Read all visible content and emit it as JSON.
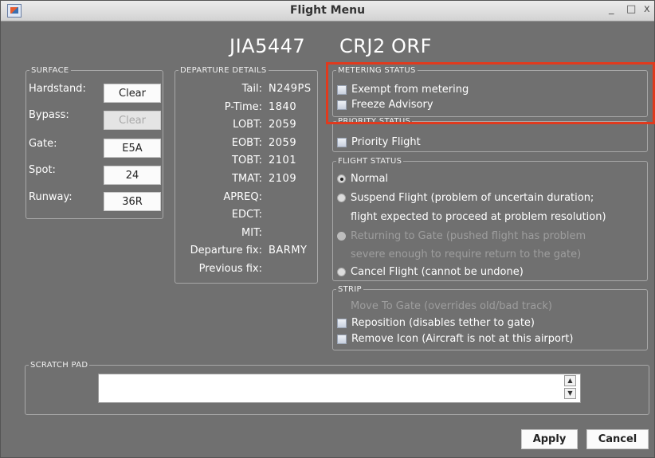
{
  "window": {
    "title": "Flight Menu",
    "minimize": "_",
    "maximize": "□",
    "close": "x"
  },
  "header": {
    "callsign": "JIA5447",
    "aircraft": "CRJ2",
    "airport": "ORF"
  },
  "surface": {
    "legend": "SURFACE",
    "hardstand": {
      "label": "Hardstand:",
      "button": "Clear"
    },
    "bypass": {
      "label": "Bypass:",
      "button": "Clear"
    },
    "gate": {
      "label": "Gate:",
      "button": "E5A"
    },
    "spot": {
      "label": "Spot:",
      "button": "24"
    },
    "runway": {
      "label": "Runway:",
      "button": "36R"
    }
  },
  "departure": {
    "legend": "DEPARTURE DETAILS",
    "fields": [
      {
        "label": "Tail:",
        "value": "N249PS"
      },
      {
        "label": "P-Time:",
        "value": "1840"
      },
      {
        "label": "LOBT:",
        "value": "2059"
      },
      {
        "label": "EOBT:",
        "value": "2059"
      },
      {
        "label": "TOBT:",
        "value": "2101"
      },
      {
        "label": "TMAT:",
        "value": "2109"
      },
      {
        "label": "APREQ:",
        "value": ""
      },
      {
        "label": "EDCT:",
        "value": ""
      },
      {
        "label": "MIT:",
        "value": ""
      },
      {
        "label": "Departure fix:",
        "value": "BARMY"
      },
      {
        "label": "Previous fix:",
        "value": ""
      }
    ]
  },
  "metering": {
    "legend": "METERING STATUS",
    "exempt": "Exempt from metering",
    "freeze": "Freeze Advisory"
  },
  "priority": {
    "legend": "PRIORITY STATUS",
    "flight": "Priority Flight"
  },
  "flight_status": {
    "legend": "FLIGHT STATUS",
    "normal": "Normal",
    "suspend_1": "Suspend Flight (problem of uncertain duration;",
    "suspend_2": "flight expected to proceed at problem resolution)",
    "returning_1": "Returning to Gate (pushed flight has problem",
    "returning_2": "severe enough to require return to the gate)",
    "cancel": "Cancel Flight (cannot be undone)"
  },
  "strip": {
    "legend": "STRIP",
    "move": "Move To Gate (overrides old/bad track)",
    "reposition": "Reposition (disables tether to gate)",
    "remove": "Remove Icon (Aircraft is not at this airport)"
  },
  "scratch_pad": {
    "legend": "SCRATCH PAD",
    "value": ""
  },
  "actions": {
    "apply": "Apply",
    "cancel": "Cancel"
  },
  "colors": {
    "highlight": "#e03a1e",
    "background": "#707070"
  }
}
